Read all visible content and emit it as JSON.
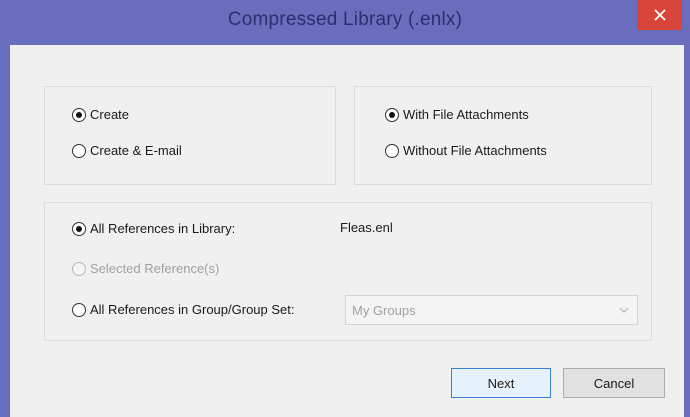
{
  "window": {
    "title": "Compressed Library (.enlx)",
    "close_icon": "close-icon"
  },
  "mode_group": {
    "options": [
      {
        "label": "Create",
        "checked": true
      },
      {
        "label": "Create & E-mail",
        "checked": false
      }
    ]
  },
  "attachments_group": {
    "options": [
      {
        "label": "With File Attachments",
        "checked": true
      },
      {
        "label": "Without File Attachments",
        "checked": false
      }
    ]
  },
  "references_group": {
    "all_references": {
      "label": "All References in Library:",
      "checked": true,
      "value": "Fleas.enl"
    },
    "selected_references": {
      "label": "Selected Reference(s)",
      "checked": false,
      "disabled": true
    },
    "group_set": {
      "label": "All References in Group/Group Set:",
      "checked": false,
      "selected": "My Groups"
    }
  },
  "buttons": {
    "next": "Next",
    "cancel": "Cancel"
  },
  "colors": {
    "title_bar": "#6a6dbd",
    "close_button": "#d9443a",
    "dialog_background": "#f0f0f0"
  }
}
